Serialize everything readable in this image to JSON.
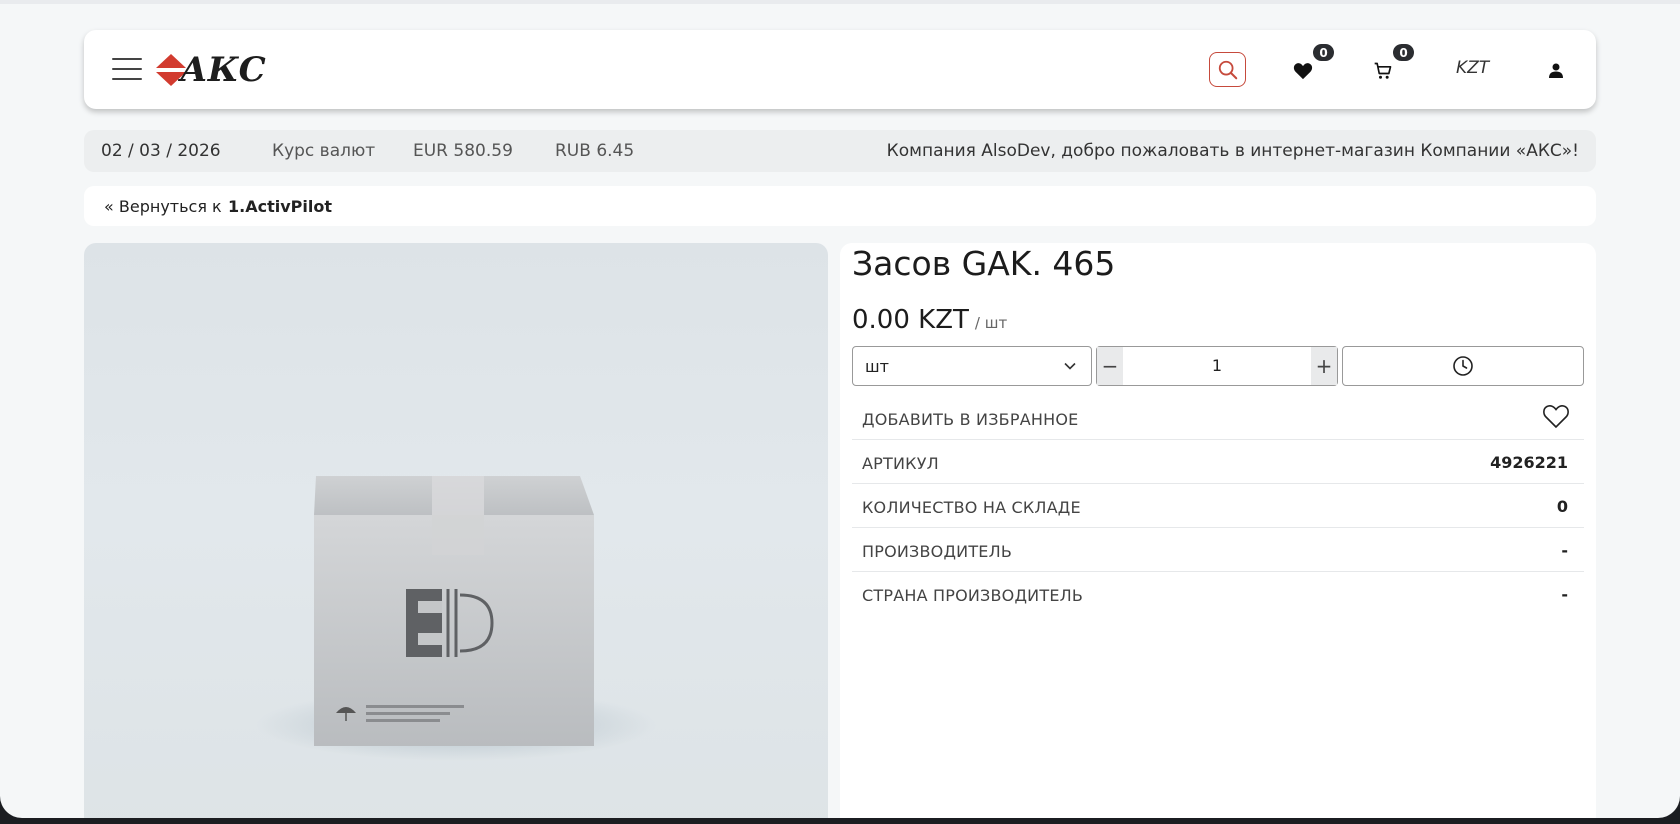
{
  "header": {
    "logo_text": "АКС",
    "currency": "KZT",
    "favorites_count": "0",
    "cart_count": "0",
    "accent_color": "#c64a3c"
  },
  "infobar": {
    "date": "02 / 03 / 2026",
    "rates_label": "Курс валют",
    "eur": "EUR 580.59",
    "rub": "RUB 6.45",
    "welcome": "Компания AlsoDev, добро пожаловать в интернет-магазин Компании «АКС»!"
  },
  "breadcrumb": {
    "back_label": "« Вернуться к",
    "category": "1.ActivPilot"
  },
  "product": {
    "title": "Засов GAK. 465",
    "price": "0.00 KZT",
    "price_unit": "/ шт",
    "unit_selected": "шт",
    "quantity": "1",
    "minus": "−",
    "plus": "+",
    "specs": [
      {
        "key": "ДОБАВИТЬ В ИЗБРАННОЕ",
        "value": ""
      },
      {
        "key": "АРТИКУЛ",
        "value": "4926221"
      },
      {
        "key": "КОЛИЧЕСТВО НА СКЛАДЕ",
        "value": "0"
      },
      {
        "key": "ПРОИЗВОДИТЕЛЬ",
        "value": "-"
      },
      {
        "key": "СТРАНА ПРОИЗВОДИТЕЛЬ",
        "value": "-"
      }
    ]
  },
  "icons": [
    "menu-icon",
    "search-icon",
    "heart-icon",
    "cart-icon",
    "user-icon",
    "chevron-down-icon",
    "clock-icon",
    "heart-outline-icon",
    "box-placeholder-image"
  ]
}
